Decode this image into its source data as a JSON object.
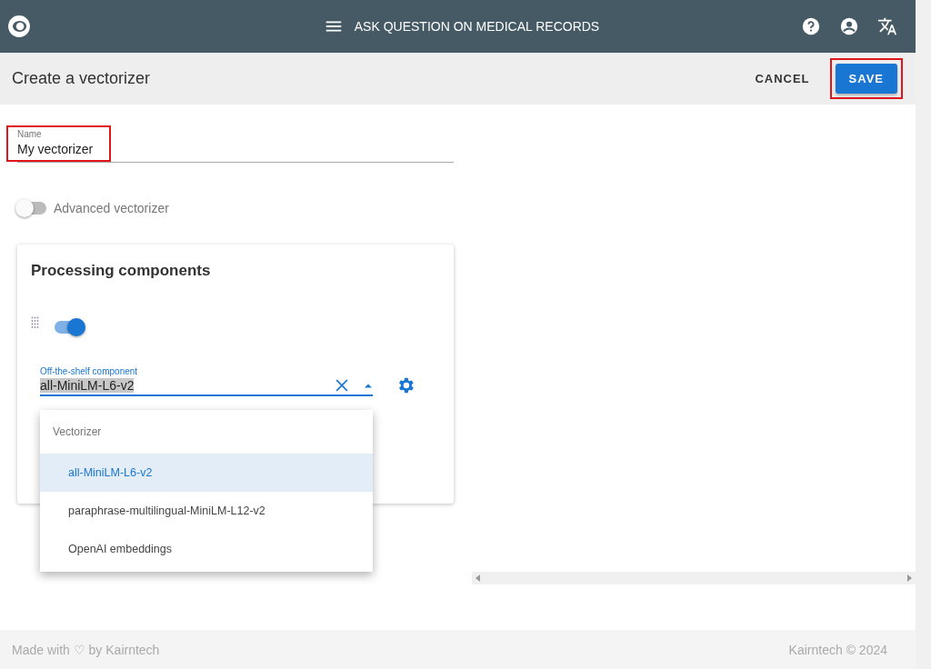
{
  "header": {
    "title": "ASK QUESTION ON MEDICAL RECORDS"
  },
  "toolbar": {
    "title": "Create a vectorizer",
    "cancel": "CANCEL",
    "save": {
      "label": "SAVE",
      "highlighted": true
    }
  },
  "name_field": {
    "label": "Name",
    "value": "My vectorizer",
    "highlighted": true
  },
  "advanced_toggle": {
    "label": "Advanced vectorizer",
    "on": false
  },
  "card": {
    "title": "Processing components",
    "component_toggle_on": true,
    "component_select": {
      "label": "Off-the-shelf component",
      "value": "all-MiniLM-L6-v2",
      "expanded": true,
      "menu": {
        "header": "Vectorizer",
        "items": [
          {
            "label": "all-MiniLM-L6-v2",
            "selected": true
          },
          {
            "label": "paraphrase-multilingual-MiniLM-L12-v2",
            "selected": false
          },
          {
            "label": "OpenAI embeddings",
            "selected": false
          }
        ]
      }
    }
  },
  "footer": {
    "left": "Made with ♡ by Kairntech",
    "right": "Kairntech © 2024"
  }
}
